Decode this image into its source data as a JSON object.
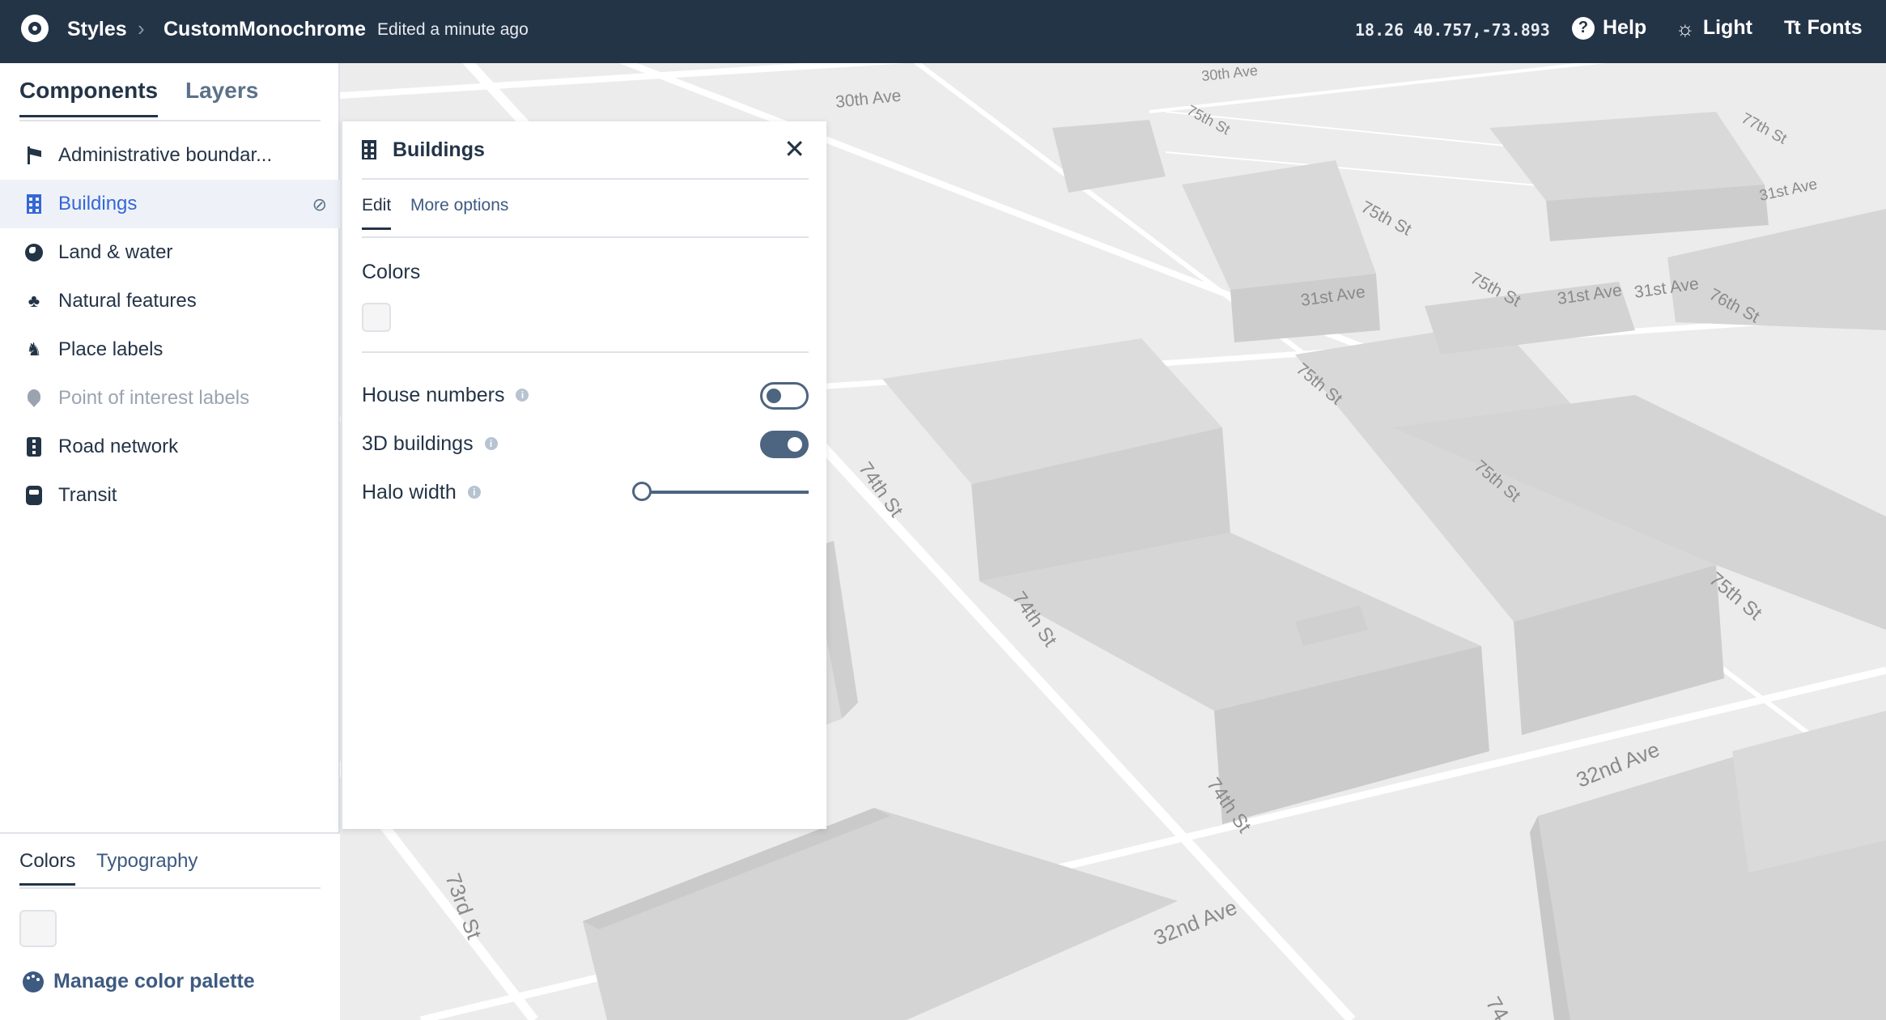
{
  "header": {
    "breadcrumb_root": "Styles",
    "style_name": "CustomMonochrome",
    "edited": "Edited a minute ago",
    "coords": "18.26 40.757,-73.893",
    "help_label": "Help",
    "theme_label": "Light",
    "fonts_label": "Fonts"
  },
  "sidebar": {
    "tabs": [
      "Components",
      "Layers"
    ],
    "items": [
      {
        "label": "Administrative boundar...",
        "icon": "flag-icon"
      },
      {
        "label": "Buildings",
        "icon": "building-icon",
        "selected": true
      },
      {
        "label": "Land & water",
        "icon": "globe-icon"
      },
      {
        "label": "Natural features",
        "icon": "trees-icon"
      },
      {
        "label": "Place labels",
        "icon": "place-icon"
      },
      {
        "label": "Point of interest labels",
        "icon": "pin-icon",
        "disabled": true
      },
      {
        "label": "Road network",
        "icon": "road-icon"
      },
      {
        "label": "Transit",
        "icon": "train-icon"
      }
    ],
    "bottom_tabs": [
      "Colors",
      "Typography"
    ],
    "manage_palette": "Manage color palette"
  },
  "panel": {
    "title": "Buildings",
    "tabs": [
      "Edit",
      "More options"
    ],
    "colors_label": "Colors",
    "options": [
      {
        "label": "House numbers",
        "type": "toggle",
        "value": false
      },
      {
        "label": "3D buildings",
        "type": "toggle",
        "value": true
      },
      {
        "label": "Halo width",
        "type": "slider",
        "value": 0
      }
    ]
  },
  "map": {
    "street_labels": [
      "30th Ave",
      "30th Ave",
      "75th St",
      "75th St",
      "75th St",
      "31st Ave",
      "31st Ave",
      "31st Ave",
      "77th St",
      "31st Ave",
      "76th St",
      "75th St",
      "75th St",
      "74th St",
      "74th St",
      "74th St",
      "75th St",
      "32nd Ave",
      "32nd Ave",
      "73rd St",
      "74"
    ],
    "colors": {
      "background": "#ececec",
      "road": "#ffffff",
      "building_top": "#dcdcdc",
      "building_side": "#cfcfcf"
    }
  }
}
